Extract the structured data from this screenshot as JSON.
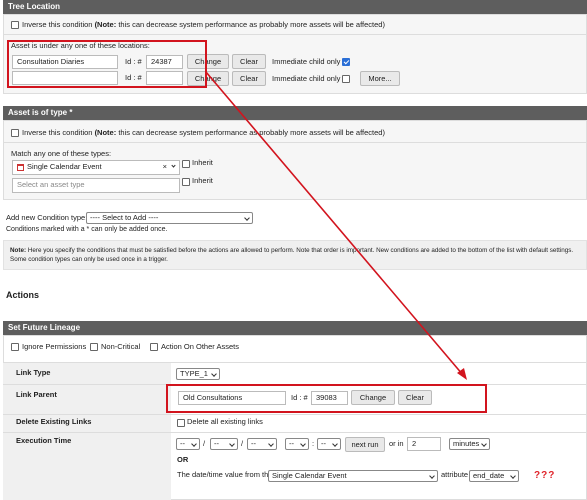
{
  "tree_location": {
    "title": "Tree Location",
    "inverse_label": "Inverse this condition",
    "inverse_note_bold": "(Note:",
    "inverse_note_rest": "this can decrease system performance as probably more assets will be affected)",
    "under_label": "Asset is under any one of these locations:",
    "rows": [
      {
        "name": "Consultation Diaries",
        "id_label": "Id : #",
        "id": "24387",
        "change": "Change",
        "clear": "Clear",
        "child_label": "Immediate child only",
        "checked": true
      },
      {
        "name": "",
        "id_label": "Id : #",
        "id": "",
        "change": "Change",
        "clear": "Clear",
        "child_label": "Immediate child only",
        "checked": false
      }
    ],
    "more_button": "More..."
  },
  "asset_type": {
    "title": "Asset is of type *",
    "inverse_label": "Inverse this condition",
    "inverse_note_bold": "(Note:",
    "inverse_note_rest": "this can decrease system performance as probably more assets will be affected)",
    "match_label": "Match any one of these types:",
    "selected_type": "Single Calendar Event",
    "clear_x": "×",
    "inherit_label": "Inherit",
    "placeholder": "Select an asset type"
  },
  "add_condition": {
    "label": "Add new Condition type:",
    "select_value": "---- Select to Add ----",
    "marked_note": "Conditions marked with a * can only be added once.",
    "note_bold": "Note:",
    "note_line1": "Here you specify the conditions that must be satisfied before the actions are allowed to perform. Note that order is important. New conditions are added to the bottom of the list with default settings.",
    "note_line2": "Some condition types can only be used once in a trigger."
  },
  "actions": {
    "heading": "Actions",
    "future_lineage": {
      "title": "Set Future Lineage",
      "ignore_permissions": "Ignore Permissions",
      "non_critical": "Non-Critical",
      "action_on_other": "Action On Other Assets",
      "link_type_label": "Link Type",
      "link_type_value": "TYPE_1",
      "link_parent_label": "Link Parent",
      "link_parent_name": "Old Consultations",
      "link_parent_id_label": "Id : #",
      "link_parent_id": "39083",
      "change": "Change",
      "clear": "Clear",
      "delete_links_label": "Delete Existing Links",
      "delete_all_label": "Delete all existing links",
      "execution_time_label": "Execution Time",
      "dash": "--",
      "slash": "/",
      "colon": ":",
      "next_run": "next run",
      "or_in": "or in",
      "or_in_value": "2",
      "minutes": "minutes",
      "or": "OR",
      "datetime_from_label": "The date/time value from the",
      "datetime_from_value": "Single Calendar Event",
      "attribute_label": "attribute",
      "attribute_value": "end_date",
      "annotation": "???"
    }
  },
  "colors": {
    "header_bar": "#5e5e5e",
    "annotation_red": "#d2141e",
    "checkbox_blue": "#2b6fd6"
  }
}
